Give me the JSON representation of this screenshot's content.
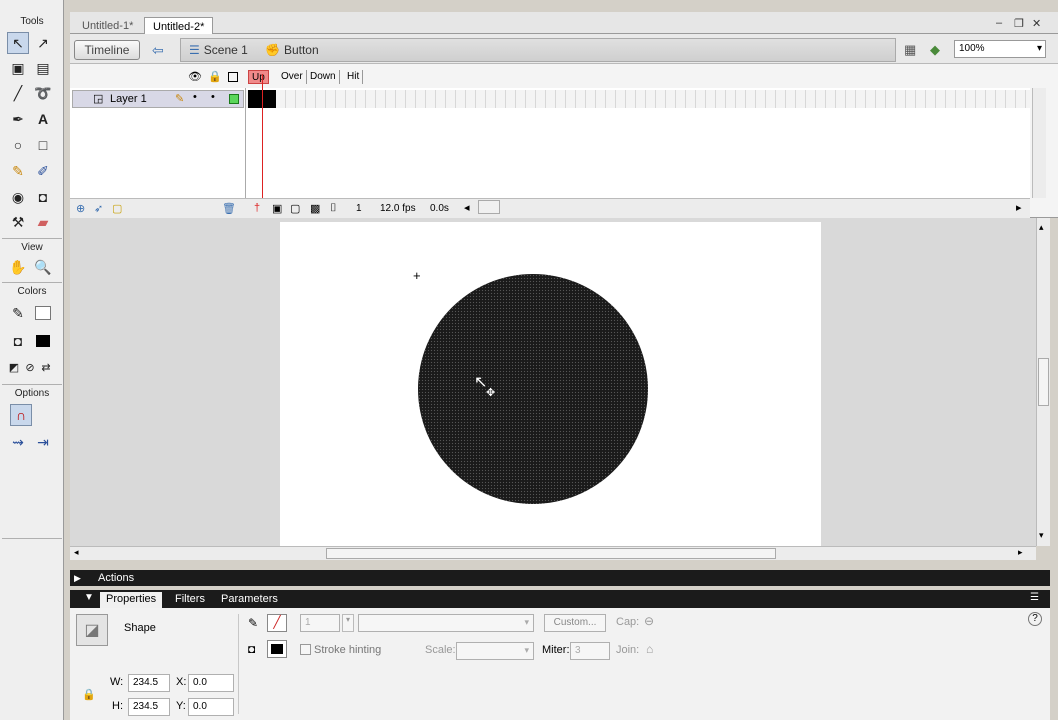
{
  "tools": {
    "header": "Tools",
    "view_header": "View",
    "colors_header": "Colors",
    "options_header": "Options"
  },
  "doc_tabs": [
    {
      "label": "Untitled-1*"
    },
    {
      "label": "Untitled-2*"
    }
  ],
  "editbar": {
    "timeline_label": "Timeline",
    "scene_label": "Scene 1",
    "symbol_label": "Button",
    "zoom_value": "100%"
  },
  "timeline": {
    "frames": [
      "Up",
      "Over",
      "Down",
      "Hit"
    ],
    "layer_name": "Layer 1",
    "current_frame": "1",
    "fps": "12.0 fps",
    "elapsed": "0.0s"
  },
  "panels": {
    "actions_label": "Actions",
    "tabs": [
      "Properties",
      "Filters",
      "Parameters"
    ]
  },
  "properties": {
    "type_label": "Shape",
    "stroke_value": "1",
    "custom_label": "Custom...",
    "cap_label": "Cap:",
    "stroke_hinting_label": "Stroke hinting",
    "scale_label": "Scale:",
    "miter_label": "Miter:",
    "miter_value": "3",
    "join_label": "Join:",
    "w_label": "W:",
    "w_value": "234.5",
    "h_label": "H:",
    "h_value": "234.5",
    "x_label": "X:",
    "x_value": "0.0",
    "y_label": "Y:",
    "y_value": "0.0"
  }
}
